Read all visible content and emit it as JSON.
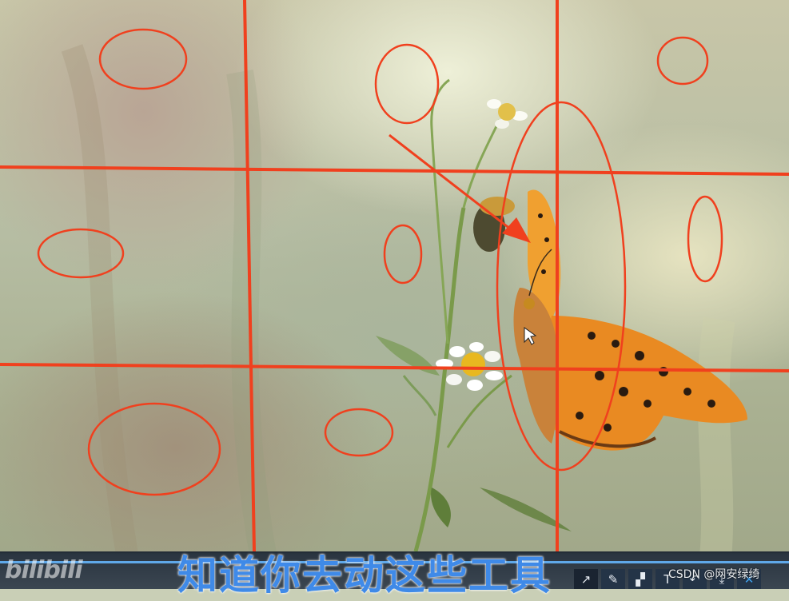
{
  "video": {
    "platform_logo": "bilibili",
    "subtitle": "知道你去动这些工具"
  },
  "toolbar": {
    "tools": [
      {
        "name": "arrow-icon",
        "glyph": "↗"
      },
      {
        "name": "pen-icon",
        "glyph": "✎"
      },
      {
        "name": "mosaic-icon",
        "glyph": "▞"
      },
      {
        "name": "text-icon",
        "glyph": "T"
      },
      {
        "name": "undo-icon",
        "glyph": "↶"
      },
      {
        "name": "download-icon",
        "glyph": "⤓"
      },
      {
        "name": "close-icon",
        "glyph": "✕"
      }
    ]
  },
  "watermark": "CSDN @网安绿绮",
  "colors": {
    "annotation_red": "#f0401e",
    "subtitle_blue": "#3f8ae8",
    "toolbar_bg": "#243447"
  }
}
